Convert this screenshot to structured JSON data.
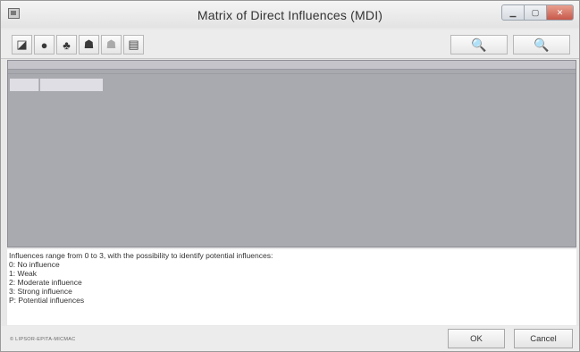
{
  "window": {
    "title": "Matrix of Direct Influences (MDI)"
  },
  "toolbar": {
    "buttons": [
      {
        "icon": "edit-icon",
        "glyph": "◪"
      },
      {
        "icon": "palette-icon",
        "glyph": "●"
      },
      {
        "icon": "print-icon",
        "glyph": "♣"
      },
      {
        "icon": "actor-icon",
        "glyph": "☗"
      },
      {
        "icon": "actor-faded-icon",
        "glyph": "☗"
      },
      {
        "icon": "printer-icon",
        "glyph": "▤"
      }
    ],
    "zoom_in_glyph": "🔍",
    "zoom_out_glyph": "🔍"
  },
  "legend": {
    "lines": [
      "Influences range from 0 to 3, with the possibility to identify potential influences:",
      "0: No influence",
      "1: Weak",
      "2: Moderate influence",
      "3: Strong influence",
      "P: Potential influences"
    ]
  },
  "footer": {
    "copyright": "© LIPSOR-EPITA-MICMAC",
    "ok_label": "OK",
    "cancel_label": "Cancel"
  },
  "colors": {
    "matrix_bg": "#a9a9b0",
    "close_button": "#c6584a"
  }
}
